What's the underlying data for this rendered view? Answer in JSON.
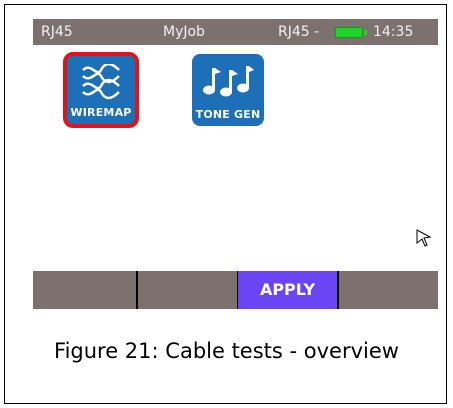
{
  "statusbar": {
    "field1": "RJ45",
    "field2": "MyJob",
    "field3": "RJ45 -",
    "time": "14:35",
    "battery_color": "#1ed42b"
  },
  "apps": [
    {
      "label": "WIREMAP",
      "icon": "wiremap-icon",
      "selected": true
    },
    {
      "label": "TONE GEN",
      "icon": "music-notes-icon",
      "selected": false
    }
  ],
  "softkeys": [
    "",
    "",
    "APPLY",
    ""
  ],
  "caption": "Figure 21: Cable tests - overview",
  "colors": {
    "bar": "#7d7170",
    "app_bg": "#1d6fb8",
    "selection": "#e0141b",
    "apply": "#6a44f5"
  }
}
